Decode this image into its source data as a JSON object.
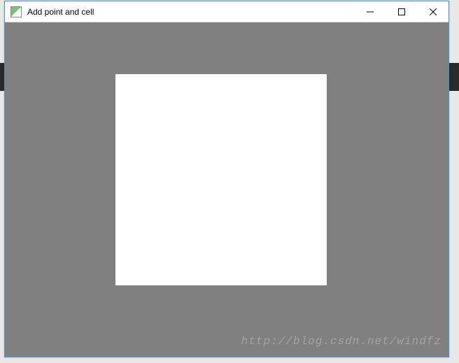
{
  "window": {
    "title": "Add point and cell"
  },
  "watermark": {
    "text": "http://blog.csdn.net/windfz"
  },
  "colors": {
    "client_bg": "#808080",
    "canvas_fill": "#ffffff",
    "window_border": "#4a90d9"
  }
}
